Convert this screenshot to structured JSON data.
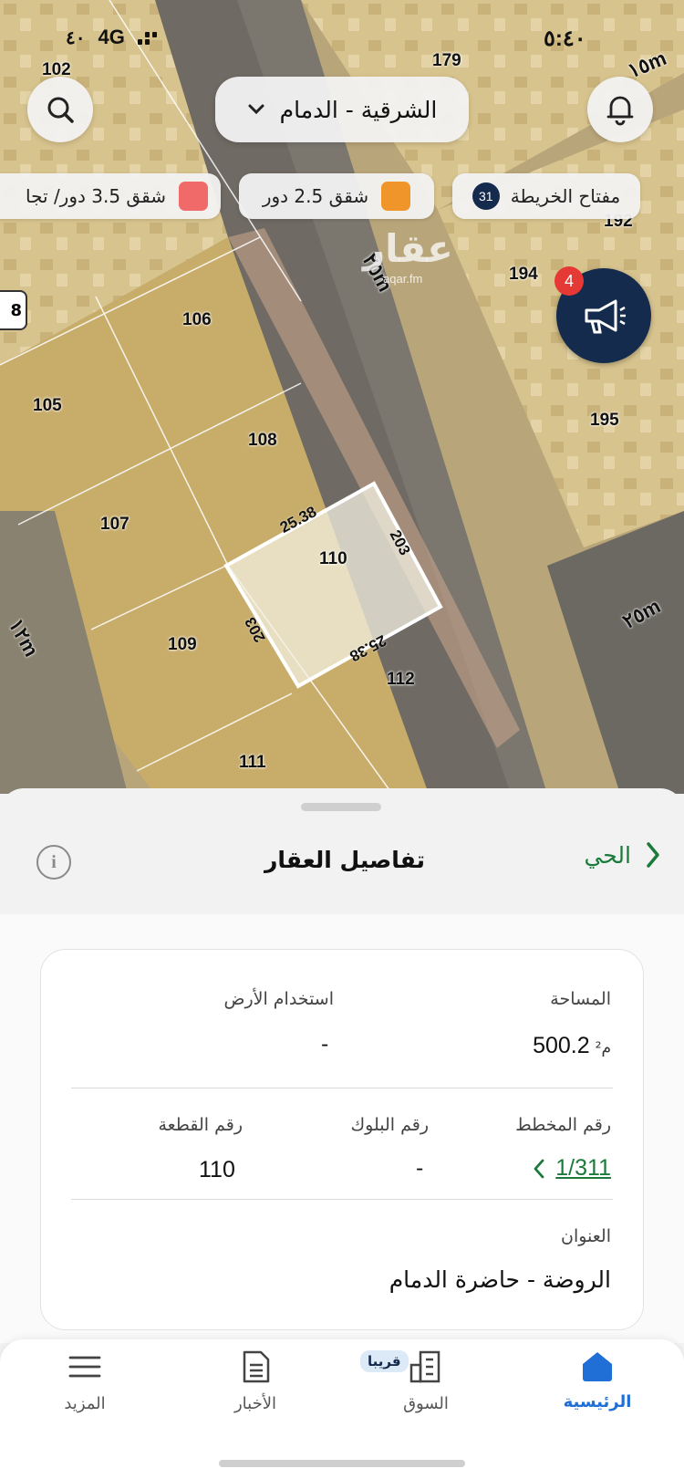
{
  "status_bar": {
    "time": "٥:٤٠",
    "network": "4G",
    "battery": "٤٠"
  },
  "search": {
    "region_label": "الشرقية - الدمام"
  },
  "chips": [
    {
      "label": "مفتاح الخريطة",
      "count": "31"
    },
    {
      "label": "شقق 2.5 دور",
      "color": "#f0952a"
    },
    {
      "label": "شقق 3.5 دور/ تجا",
      "color": "#f06a6a"
    }
  ],
  "notification_count": "4",
  "watermark": "عقار",
  "watermark_url": "aqar.fm",
  "map": {
    "plots": [
      "102",
      "179",
      "192",
      "194",
      "195",
      "106",
      "105",
      "108",
      "107",
      "110",
      "109",
      "112",
      "111"
    ],
    "dimensions": [
      "25.38",
      "203",
      "203",
      "25.38"
    ],
    "streets": [
      "١٥m",
      "٢٥m",
      "٢٥m",
      "١٢m"
    ],
    "edge_marker": "8"
  },
  "sheet": {
    "title": "تفاصيل العقار",
    "back_label": "الحي"
  },
  "details": {
    "area_label": "المساحة",
    "area_value": "500.2",
    "area_unit": "م²",
    "land_use_label": "استخدام الأرض",
    "land_use_value": "-",
    "plan_label": "رقم المخطط",
    "plan_value": "1/311",
    "block_label": "رقم البلوك",
    "block_value": "-",
    "parcel_label": "رقم القطعة",
    "parcel_value": "110",
    "address_label": "العنوان",
    "address_value": "الروضة - حاضرة الدمام"
  },
  "nav": {
    "home": "الرئيسية",
    "market": "السوق",
    "market_badge": "قريبا",
    "news": "الأخبار",
    "more": "المزيد"
  },
  "colors": {
    "accent_green": "#1a7a3a",
    "home_blue": "#1f6fd6",
    "navy": "#142b4e"
  }
}
